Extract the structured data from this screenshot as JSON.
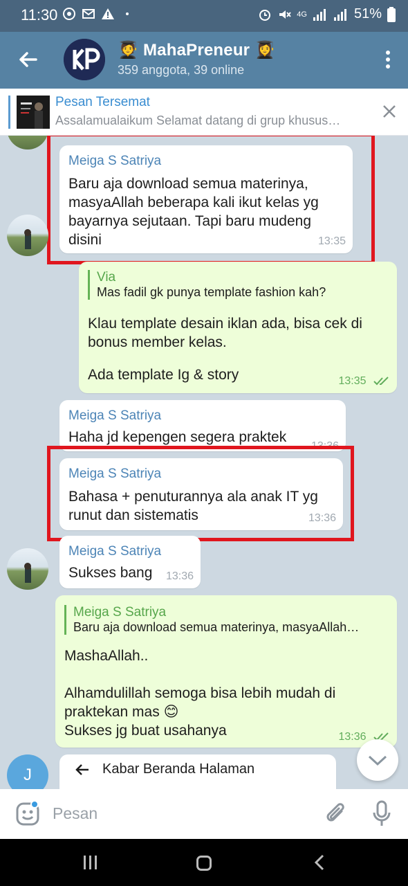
{
  "status_bar": {
    "time": "11:30",
    "network": "4G",
    "battery": "51%"
  },
  "header": {
    "group_name": "MahaPreneur",
    "title_emoji_left": "🧑‍🎓",
    "title_emoji_right": "👩‍🎓",
    "subtitle": "359 anggota, 39 online"
  },
  "pinned": {
    "title": "Pesan Tersemat",
    "text": "Assalamualaikum Selamat datang di grup khusus…"
  },
  "messages": [
    {
      "sender": "Meiga S Satriya",
      "text": "Baru aja download semua materinya, masyaAllah beberapa kali ikut kelas yg bayarnya sejutaan. Tapi baru mudeng disini",
      "time": "13:35"
    },
    {
      "reply_name": "Via",
      "reply_text": "Mas fadil gk punya template fashion kah?",
      "text1": "Klau template desain iklan ada, bisa cek di bonus member kelas.",
      "text2": "Ada template Ig & story",
      "time": "13:35"
    },
    {
      "sender": "Meiga S Satriya",
      "text": "Haha jd kepengen segera praktek",
      "time": "13:36"
    },
    {
      "sender": "Meiga S Satriya",
      "text": "Bahasa + penuturannya ala anak IT yg runut dan sistematis",
      "time": "13:36"
    },
    {
      "sender": "Meiga S Satriya",
      "text": "Sukses bang",
      "time": "13:36"
    },
    {
      "reply_name": "Meiga S Satriya",
      "reply_text": "Baru aja download semua materinya, masyaAllah…",
      "line1": "MashaAllah..",
      "line2": "Alhamdulillah semoga bisa lebih mudah di praktekan mas 😊",
      "line3": "Sukses jg buat usahanya",
      "time": "13:36"
    },
    {
      "avatar_letter": "J",
      "text": "Kabar Beranda Halaman"
    }
  ],
  "input": {
    "placeholder": "Pesan"
  },
  "colors": {
    "header": "#5682a3",
    "status_bar": "#49657e",
    "outgoing": "#eefed9",
    "highlight": "#e0161e"
  }
}
